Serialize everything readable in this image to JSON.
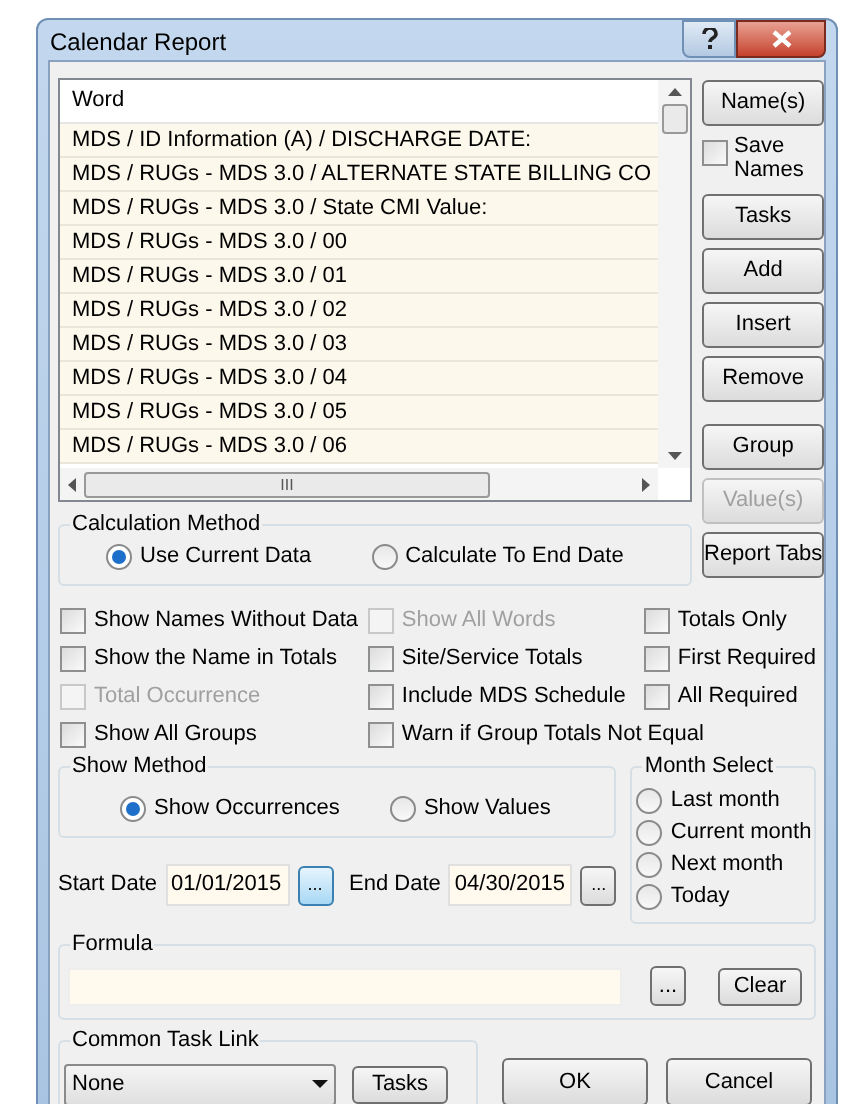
{
  "window": {
    "title": "Calendar Report"
  },
  "word_list": {
    "header": "Word",
    "rows": [
      "MDS / ID Information (A) / DISCHARGE DATE:",
      "MDS / RUGs - MDS 3.0 / ALTERNATE STATE BILLING CO",
      "MDS / RUGs - MDS 3.0 / State CMI Value:",
      "MDS / RUGs - MDS 3.0 / 00",
      "MDS / RUGs - MDS 3.0 / 01",
      "MDS / RUGs - MDS 3.0 / 02",
      "MDS / RUGs - MDS 3.0 / 03",
      "MDS / RUGs - MDS 3.0 / 04",
      "MDS / RUGs - MDS 3.0 / 05",
      "MDS / RUGs - MDS 3.0 / 06"
    ],
    "scroll_arrow": "III"
  },
  "side_controls": [
    {
      "kind": "button",
      "label": "Name(s)",
      "disabled": false
    },
    {
      "kind": "checkbox",
      "label": "Save Names",
      "checked": false
    },
    {
      "kind": "button",
      "label": "Tasks",
      "disabled": false
    },
    {
      "kind": "button",
      "label": "Add",
      "disabled": false
    },
    {
      "kind": "button",
      "label": "Insert",
      "disabled": false
    },
    {
      "kind": "button",
      "label": "Remove",
      "disabled": false
    },
    {
      "kind": "gap"
    },
    {
      "kind": "button",
      "label": "Group",
      "disabled": false
    },
    {
      "kind": "button",
      "label": "Value(s)",
      "disabled": true
    },
    {
      "kind": "button",
      "label": "Report Tabs",
      "disabled": false
    }
  ],
  "calculation_method": {
    "title": "Calculation Method",
    "options": [
      {
        "label": "Use Current Data",
        "selected": true
      },
      {
        "label": "Calculate To End Date",
        "selected": false
      }
    ]
  },
  "option_columns": [
    [
      {
        "label": "Show Names Without Data",
        "checked": false,
        "disabled": false
      },
      {
        "label": "Show the Name in Totals",
        "checked": false,
        "disabled": false
      },
      {
        "label": "Total Occurrence",
        "checked": false,
        "disabled": true
      },
      {
        "label": "Show All Groups",
        "checked": false,
        "disabled": false
      }
    ],
    [
      {
        "label": "Show All Words",
        "checked": false,
        "disabled": true
      },
      {
        "label": "Site/Service Totals",
        "checked": false,
        "disabled": false
      },
      {
        "label": "Include MDS Schedule",
        "checked": false,
        "disabled": false
      },
      {
        "label": "Warn if Group Totals Not Equal",
        "checked": false,
        "disabled": false
      }
    ],
    [
      {
        "label": "Totals Only",
        "checked": false,
        "disabled": false
      },
      {
        "label": "First Required",
        "checked": false,
        "disabled": false
      },
      {
        "label": "All Required",
        "checked": false,
        "disabled": false
      }
    ]
  ],
  "show_method": {
    "title": "Show Method",
    "options": [
      {
        "label": "Show Occurrences",
        "selected": true
      },
      {
        "label": "Show Values",
        "selected": false
      }
    ]
  },
  "month_select": {
    "title": "Month Select",
    "options": [
      {
        "label": "Last month",
        "selected": false
      },
      {
        "label": "Current month",
        "selected": false
      },
      {
        "label": "Next month",
        "selected": false
      },
      {
        "label": "Today",
        "selected": false
      }
    ]
  },
  "start_date": {
    "label": "Start Date",
    "value": "01/01/2015",
    "picker": "...",
    "picker_focused": true
  },
  "end_date": {
    "label": "End Date",
    "value": "04/30/2015",
    "picker": "...",
    "picker_focused": false
  },
  "formula": {
    "title": "Formula",
    "browse": "...",
    "clear": "Clear"
  },
  "common_task_link": {
    "title": "Common Task Link",
    "value": "None",
    "button": "Tasks"
  },
  "buttons": [
    {
      "label": "OK"
    },
    {
      "label": "Cancel"
    }
  ]
}
